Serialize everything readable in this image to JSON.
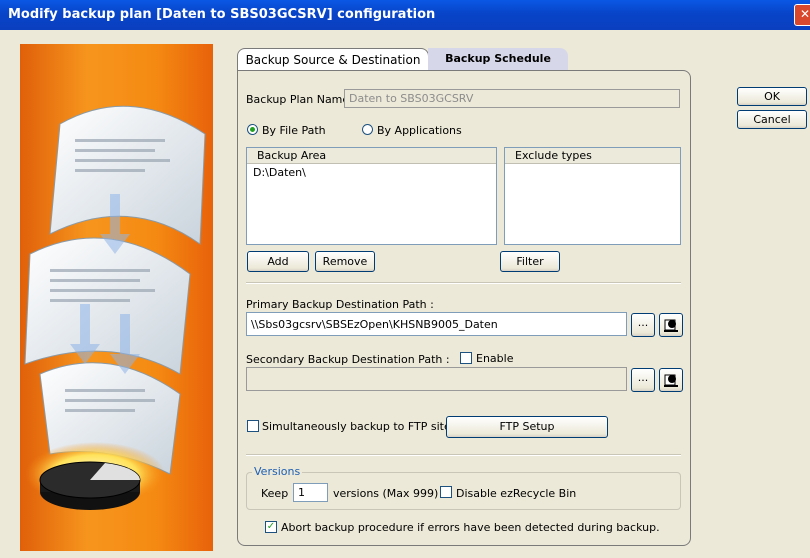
{
  "window": {
    "title": "Modify backup plan [Daten to SBS03GCSRV] configuration"
  },
  "tabs": [
    {
      "label": "Backup Source & Destination",
      "active": true
    },
    {
      "label": "Backup Schedule",
      "active": false
    }
  ],
  "buttons": {
    "ok": "OK",
    "cancel": "Cancel"
  },
  "plan": {
    "name_label": "Backup Plan Name:",
    "name_value": "Daten to SBS03GCSRV"
  },
  "source_mode": {
    "by_file_path": "By File Path",
    "by_applications": "By Applications",
    "selected": "by_file_path"
  },
  "backup_area": {
    "header": "Backup Area",
    "items": [
      "D:\\Daten\\"
    ]
  },
  "exclude_types": {
    "header": "Exclude types",
    "items": []
  },
  "area_buttons": {
    "add": "Add",
    "remove": "Remove",
    "filter": "Filter"
  },
  "primary": {
    "label": "Primary Backup Destination Path :",
    "value": "\\\\Sbs03gcsrv\\SBSEzOpen\\KHSNB9005_Daten",
    "browse": "..."
  },
  "secondary": {
    "label": "Secondary Backup Destination Path :",
    "enable_label": "Enable",
    "enabled": false,
    "value": "",
    "browse": "..."
  },
  "ftp": {
    "checkbox_label": "Simultaneously backup to FTP site",
    "checked": false,
    "setup_button": "FTP Setup"
  },
  "versions": {
    "group_title": "Versions",
    "keep_label": "Keep",
    "keep_value": "1",
    "suffix": "versions  (Max 999)",
    "disable_recycle_label": "Disable ezRecycle Bin",
    "disable_recycle_checked": false
  },
  "abort": {
    "label": "Abort backup procedure if errors have been detected during backup.",
    "checked": true
  },
  "colors": {
    "titlebar": "#0a4fd6",
    "close_button": "#d9472c",
    "banner": "#f58a12",
    "accent": "#21a121"
  }
}
